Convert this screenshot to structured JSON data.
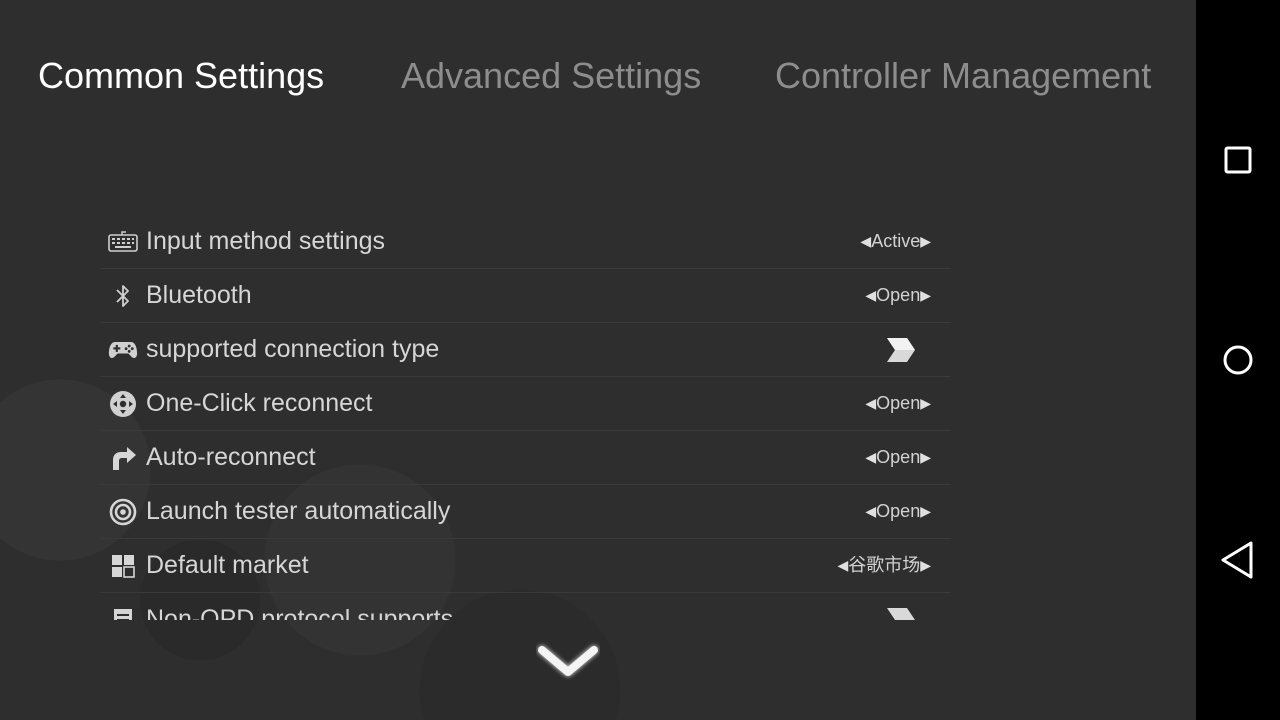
{
  "tabs": [
    {
      "label": "Common Settings",
      "active": true
    },
    {
      "label": "Advanced Settings",
      "active": false
    },
    {
      "label": "Controller Management",
      "active": false
    }
  ],
  "settings": [
    {
      "icon": "keyboard-icon",
      "label": "Input method settings",
      "value": "Active",
      "type": "selector"
    },
    {
      "icon": "bluetooth-icon",
      "label": "Bluetooth",
      "value": "Open",
      "type": "selector"
    },
    {
      "icon": "gamepad-icon",
      "label": "supported connection type",
      "value": "",
      "type": "link"
    },
    {
      "icon": "dpad-icon",
      "label": "One-Click reconnect",
      "value": "Open",
      "type": "selector"
    },
    {
      "icon": "redo-arrow-icon",
      "label": "Auto-reconnect",
      "value": "Open",
      "type": "selector"
    },
    {
      "icon": "target-icon",
      "label": "Launch tester automatically",
      "value": "Open",
      "type": "selector"
    },
    {
      "icon": "grid-icon",
      "label": "Default market",
      "value": "谷歌市场",
      "type": "selector"
    },
    {
      "icon": "document-icon",
      "label": "Non-OPD protocol supports",
      "value": "",
      "type": "link"
    }
  ],
  "navbar": {
    "buttons": [
      "recents-square-icon",
      "home-circle-icon",
      "back-triangle-icon"
    ]
  },
  "colors": {
    "background": "#2e2e2e",
    "active_tab": "#ffffff",
    "inactive_tab": "#8d8d8d",
    "navbar": "#000000"
  }
}
